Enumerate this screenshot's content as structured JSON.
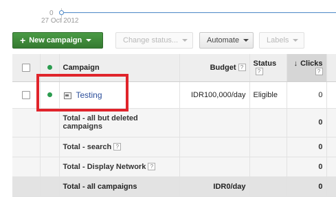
{
  "chart": {
    "zero_label": "0",
    "date_label": "27 Oct 2012"
  },
  "toolbar": {
    "new_campaign_label": "New campaign",
    "change_status_label": "Change status...",
    "automate_label": "Automate",
    "labels_label": "Labels"
  },
  "table": {
    "headers": {
      "campaign": "Campaign",
      "budget": "Budget",
      "status": "Status",
      "clicks": "Clicks"
    },
    "help_glyph": "?",
    "rows": [
      {
        "campaign": "Testing",
        "budget": "IDR100,000/day",
        "status": "Eligible",
        "clicks": "0"
      }
    ],
    "totals": [
      {
        "label": "Total - all but deleted campaigns",
        "budget": "",
        "clicks": "0"
      },
      {
        "label": "Total - search",
        "budget": "",
        "clicks": "0"
      },
      {
        "label": "Total - Display Network",
        "budget": "",
        "clicks": "0"
      }
    ],
    "footer": {
      "label": "Total - all campaigns",
      "budget": "IDR0/day",
      "clicks": "0"
    }
  },
  "colors": {
    "accent_green": "#3d8b3d",
    "status_dot": "#2b9c4f",
    "annotation_red": "#e0242b",
    "link_blue": "#2a4d9a"
  },
  "icons": {
    "plus": "plus-icon",
    "caret": "caret-down-icon",
    "sort": "sort-arrow-icon",
    "campaign": "campaign-icon"
  }
}
